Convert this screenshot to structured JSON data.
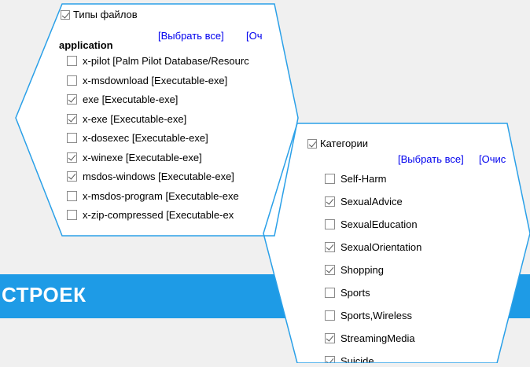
{
  "banner": {
    "text": "СТРОЕК"
  },
  "file_types_panel": {
    "header": "Типы файлов",
    "select_all": "[Выбрать все]",
    "clear": "[Оч",
    "group": "application",
    "items": [
      {
        "label": "x-pilot [Palm Pilot Database/Resourc",
        "checked": false
      },
      {
        "label": "x-msdownload [Executable-exe]",
        "checked": false
      },
      {
        "label": "exe [Executable-exe]",
        "checked": true
      },
      {
        "label": "x-exe [Executable-exe]",
        "checked": true
      },
      {
        "label": "x-dosexec [Executable-exe]",
        "checked": false
      },
      {
        "label": "x-winexe [Executable-exe]",
        "checked": true
      },
      {
        "label": "msdos-windows [Executable-exe]",
        "checked": true
      },
      {
        "label": "x-msdos-program [Executable-exe",
        "checked": false
      },
      {
        "label": "x-zip-compressed [Executable-ex",
        "checked": false
      }
    ]
  },
  "categories_panel": {
    "header": "Категории",
    "select_all": "[Выбрать все]",
    "clear": "[Очис",
    "items": [
      {
        "label": "Self-Harm",
        "checked": false
      },
      {
        "label": "SexualAdvice",
        "checked": true
      },
      {
        "label": "SexualEducation",
        "checked": false
      },
      {
        "label": "SexualOrientation",
        "checked": true
      },
      {
        "label": "Shopping",
        "checked": true
      },
      {
        "label": "Sports",
        "checked": false
      },
      {
        "label": "Sports,Wireless",
        "checked": false
      },
      {
        "label": "StreamingMedia",
        "checked": true
      },
      {
        "label": "Suicide",
        "checked": true
      }
    ]
  },
  "colors": {
    "banner": "#1e9be6",
    "frame": "#2aa0e8",
    "link": "#0000ee"
  }
}
